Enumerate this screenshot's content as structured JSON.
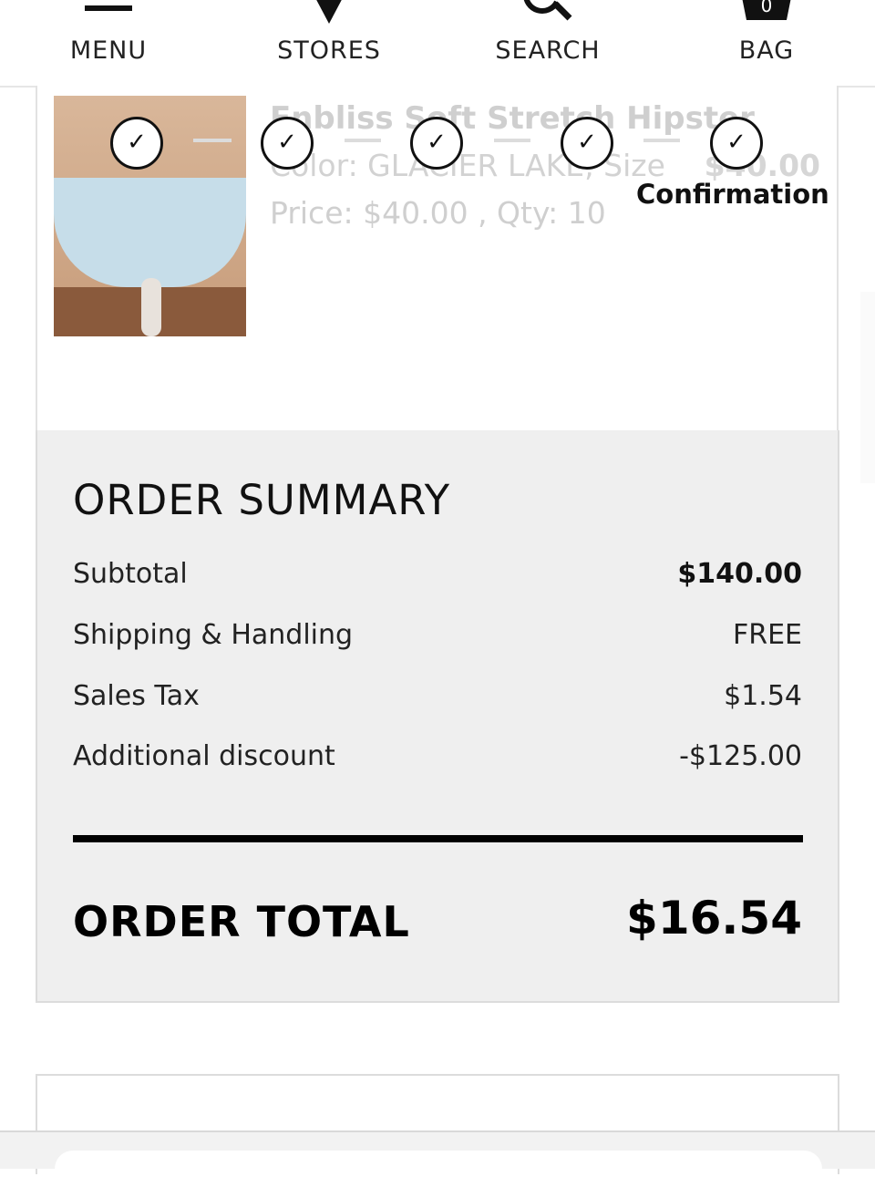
{
  "nav": {
    "menu_label": "MENU",
    "stores_label": "STORES",
    "search_label": "SEARCH",
    "bag_label": "BAG",
    "bag_count": "0"
  },
  "product": {
    "name": "Enbliss Soft Stretch Hipster",
    "color_size": "Color: GLACIER LAKE, Size",
    "line_total": "$40.00",
    "price_qty": "Price: $40.00 , Qty: 10"
  },
  "progress": {
    "step_mark": "✓",
    "current_label": "Confirmation"
  },
  "summary": {
    "title": "ORDER SUMMARY",
    "rows": [
      {
        "label": "Subtotal",
        "value": "$140.00"
      },
      {
        "label": "Shipping & Handling",
        "value": "FREE"
      },
      {
        "label": "Sales Tax",
        "value": "$1.54"
      },
      {
        "label": "Additional discount",
        "value": "-$125.00"
      }
    ],
    "total_label": "ORDER TOTAL",
    "total_value": "$16.54"
  }
}
